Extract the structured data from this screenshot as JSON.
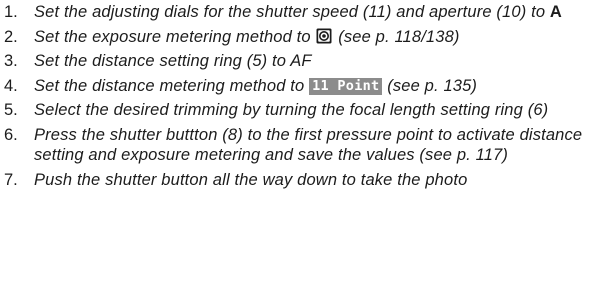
{
  "steps": [
    {
      "number": "1.",
      "text_before": "Set the adjusting dials for the shutter speed (11) and aperture (10) to ",
      "bold_value": "A"
    },
    {
      "number": "2.",
      "text_before": "Set the exposure metering method to ",
      "icon": "spot-metering-icon",
      "text_after": " (see p. 118/138)"
    },
    {
      "number": "3.",
      "text": "Set the distance setting ring (5) to AF"
    },
    {
      "number": "4.",
      "text_before": "Set the distance metering method to ",
      "badge": "11 Point",
      "text_after": " (see p. 135)"
    },
    {
      "number": "5.",
      "text": "Select the desired trimming by turning the focal length setting ring (6)"
    },
    {
      "number": "6.",
      "text": "Press the shutter buttton (8) to the first pressure point to activate distance setting and exposure metering and save the values (see p. 117)"
    },
    {
      "number": "7.",
      "text": "Push the shutter button all the way down to take the photo"
    }
  ],
  "colors": {
    "text": "#1c1c1c",
    "badge_background": "#8c8c8c",
    "badge_text": "#ffffff"
  }
}
